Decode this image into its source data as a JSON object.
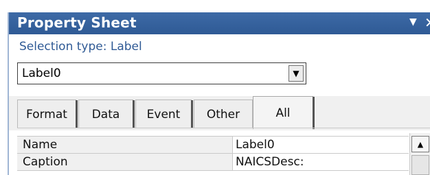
{
  "window": {
    "title": "Property Sheet",
    "menu_icon": "▼",
    "close_icon": "✕"
  },
  "selection_type": "Selection type:  Label",
  "combo": {
    "value": "Label0",
    "arrow": "▼"
  },
  "tabs": [
    {
      "label": "Format"
    },
    {
      "label": "Data"
    },
    {
      "label": "Event"
    },
    {
      "label": "Other"
    },
    {
      "label": "All",
      "active": true
    }
  ],
  "properties": [
    {
      "name": "Name",
      "value": "Label0"
    },
    {
      "name": "Caption",
      "value": "NAICSDesc:"
    }
  ],
  "scrollbar": {
    "up_arrow": "▲"
  }
}
